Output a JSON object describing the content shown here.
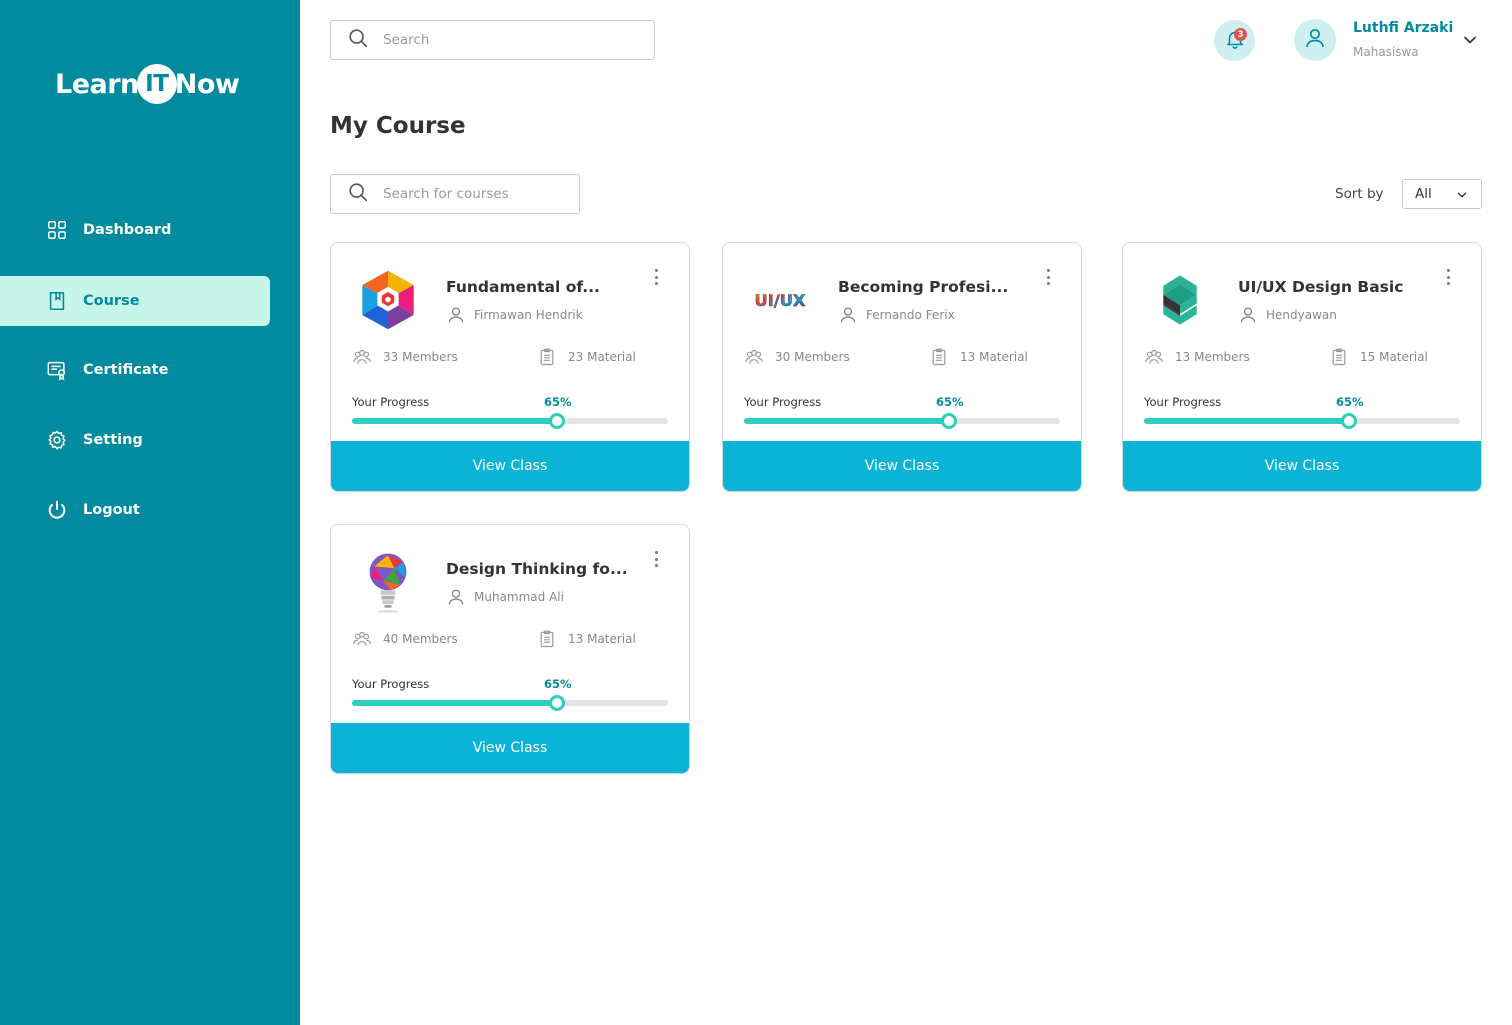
{
  "brand": {
    "part1": "Learn",
    "part2": "IT",
    "part3": "Now"
  },
  "sidebar": {
    "items": [
      {
        "label": "Dashboard",
        "icon": "grid-icon",
        "active": false
      },
      {
        "label": "Course",
        "icon": "book-icon",
        "active": true
      },
      {
        "label": "Certificate",
        "icon": "certificate-icon",
        "active": false
      },
      {
        "label": "Setting",
        "icon": "gear-icon",
        "active": false
      },
      {
        "label": "Logout",
        "icon": "power-icon",
        "active": false
      }
    ]
  },
  "header": {
    "search_placeholder": "Search",
    "notification_count": "3",
    "user_name": "Luthfi Arzaki",
    "user_role": "Mahasiswa"
  },
  "main": {
    "title": "My Course",
    "course_search_placeholder": "Search for courses",
    "sort_label": "Sort by",
    "sort_value": "All"
  },
  "courses": [
    {
      "title": "Fundamental of...",
      "mentor": "Firmawan Hendrik",
      "members": "33 Members",
      "materials": "23 Material",
      "progress_label": "Your Progress",
      "progress_text": "65%",
      "progress": 0.65,
      "button": "View Class",
      "logo": "hexagon-logo"
    },
    {
      "title": "Becoming Profesi...",
      "mentor": "Fernando Ferix",
      "members": "30 Members",
      "materials": "13 Material",
      "progress_label": "Your Progress",
      "progress_text": "65%",
      "progress": 0.65,
      "button": "View Class",
      "logo": "uiux-text-logo",
      "logo_text": "UI/UX"
    },
    {
      "title": "UI/UX Design Basic",
      "mentor": "Hendyawan",
      "members": "13 Members",
      "materials": "15 Material",
      "progress_label": "Your Progress",
      "progress_text": "65%",
      "progress": 0.65,
      "button": "View Class",
      "logo": "green-s-logo"
    },
    {
      "title": "Design Thinking fo...",
      "mentor": "Muhammad Ali",
      "members": "40 Members",
      "materials": "13 Material",
      "progress_label": "Your Progress",
      "progress_text": "65%",
      "progress": 0.65,
      "button": "View Class",
      "logo": "lightbulb-logo"
    }
  ],
  "colors": {
    "sidebar": "#028A9E",
    "active_bg": "#C7F5EA",
    "accent": "#0BB3D6",
    "progress": "#2ED0BD"
  }
}
